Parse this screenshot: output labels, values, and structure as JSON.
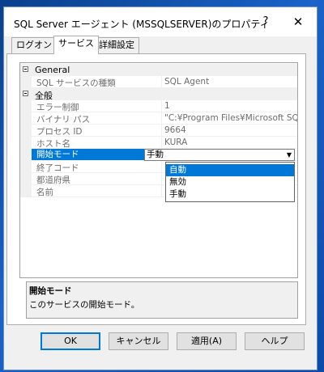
{
  "window": {
    "title": "SQL Server エージェント (MSSQLSERVER)のプロパティ",
    "help_glyph": "?",
    "close_glyph": "✕"
  },
  "tabs": [
    {
      "label": "ログオン",
      "active": false
    },
    {
      "label": "サービス",
      "active": true
    },
    {
      "label": "詳細設定",
      "active": false
    }
  ],
  "grid": {
    "categories": [
      {
        "name": "General",
        "properties": [
          {
            "name": "SQL サービスの種類",
            "value": "SQL Agent"
          }
        ]
      },
      {
        "name": "全般",
        "properties": [
          {
            "name": "エラー制御",
            "value": "1"
          },
          {
            "name": "バイナリ パス",
            "value": "\"C:¥Program Files¥Microsoft SQL Ser"
          },
          {
            "name": "プロセス ID",
            "value": "9664"
          },
          {
            "name": "ホスト名",
            "value": "KURA"
          },
          {
            "name": "開始モード",
            "value": "手動",
            "selected": true
          },
          {
            "name": "終了コード",
            "value": ""
          },
          {
            "name": "都道府県",
            "value": ""
          },
          {
            "name": "名前",
            "value": ""
          }
        ]
      }
    ]
  },
  "dropdown": {
    "value": "手動",
    "arrow_glyph": "▼",
    "options": [
      "自動",
      "無効",
      "手動"
    ],
    "highlighted": "自動"
  },
  "description": {
    "title": "開始モード",
    "text": "このサービスの開始モード。"
  },
  "buttons": {
    "ok": "OK",
    "cancel": "キャンセル",
    "apply": "適用(A)",
    "help": "ヘルプ"
  },
  "colors": {
    "selection": "#0078d7",
    "grid_gutter": "#f0f0f0",
    "desktop": "#1a63c8"
  }
}
